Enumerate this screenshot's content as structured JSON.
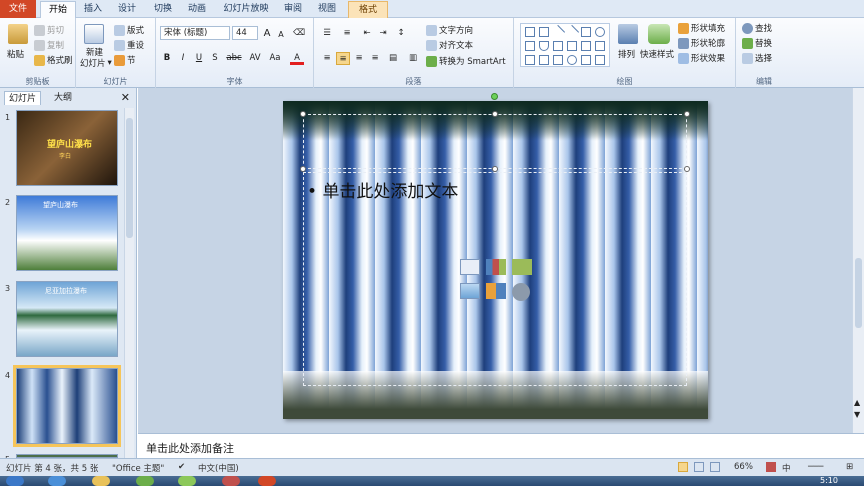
{
  "tabs": {
    "file": "文件",
    "home": "开始",
    "insert": "插入",
    "design": "设计",
    "transitions": "切换",
    "animations": "动画",
    "slideshow": "幻灯片放映",
    "review": "审阅",
    "view": "视图",
    "format": "格式"
  },
  "clipboard": {
    "paste": "粘贴",
    "cut": "剪切",
    "copy": "复制",
    "format_painter": "格式刷",
    "label": "剪贴板"
  },
  "slides_group": {
    "new_slide": "新建",
    "new_slide2": "幻灯片",
    "layout": "版式",
    "reset": "重设",
    "section": "节",
    "label": "幻灯片"
  },
  "font_group": {
    "font_name": "宋体 (标题)",
    "font_size": "44",
    "grow": "A",
    "shrink": "A",
    "bold": "B",
    "italic": "I",
    "underline": "U",
    "strike": "S",
    "abc": "abc",
    "spacing": "AV",
    "case": "Aa",
    "color": "A",
    "label": "字体"
  },
  "paragraph_group": {
    "text_direction": "文字方向",
    "align_text": "对齐文本",
    "smartart": "转换为 SmartArt",
    "label": "段落"
  },
  "drawing_group": {
    "arrange": "排列",
    "quick_styles": "快速样式",
    "shape_fill": "形状填充",
    "shape_outline": "形状轮廓",
    "shape_effects": "形状效果",
    "label": "绘图"
  },
  "editing_group": {
    "find": "查找",
    "replace": "替换",
    "select": "选择",
    "label": "编辑"
  },
  "panel": {
    "tab_slides": "幻灯片",
    "tab_outline": "大纲",
    "close": "✕",
    "thumbs": [
      {
        "num": "1",
        "title": "望庐山瀑布",
        "author": "李白"
      },
      {
        "num": "2",
        "title": "望庐山瀑布"
      },
      {
        "num": "3",
        "title": "尼亚加拉瀑布"
      },
      {
        "num": "4"
      },
      {
        "num": "5"
      }
    ]
  },
  "slide": {
    "bullet": "•",
    "body_placeholder": "单击此处添加文本"
  },
  "notes": {
    "placeholder": "单击此处添加备注"
  },
  "status": {
    "slide_info": "幻灯片 第 4 张，共 5 张",
    "theme": "\"Office 主题\"",
    "language": "中文(中国)",
    "zoom": "66%",
    "ime": "中",
    "time": "5:10"
  },
  "colors": {
    "file_tab": "#d24726",
    "context_tab": "#fbe3b8",
    "selected_thumb": "#f6c55a",
    "ribbon_bg": "#e4ecf7"
  }
}
